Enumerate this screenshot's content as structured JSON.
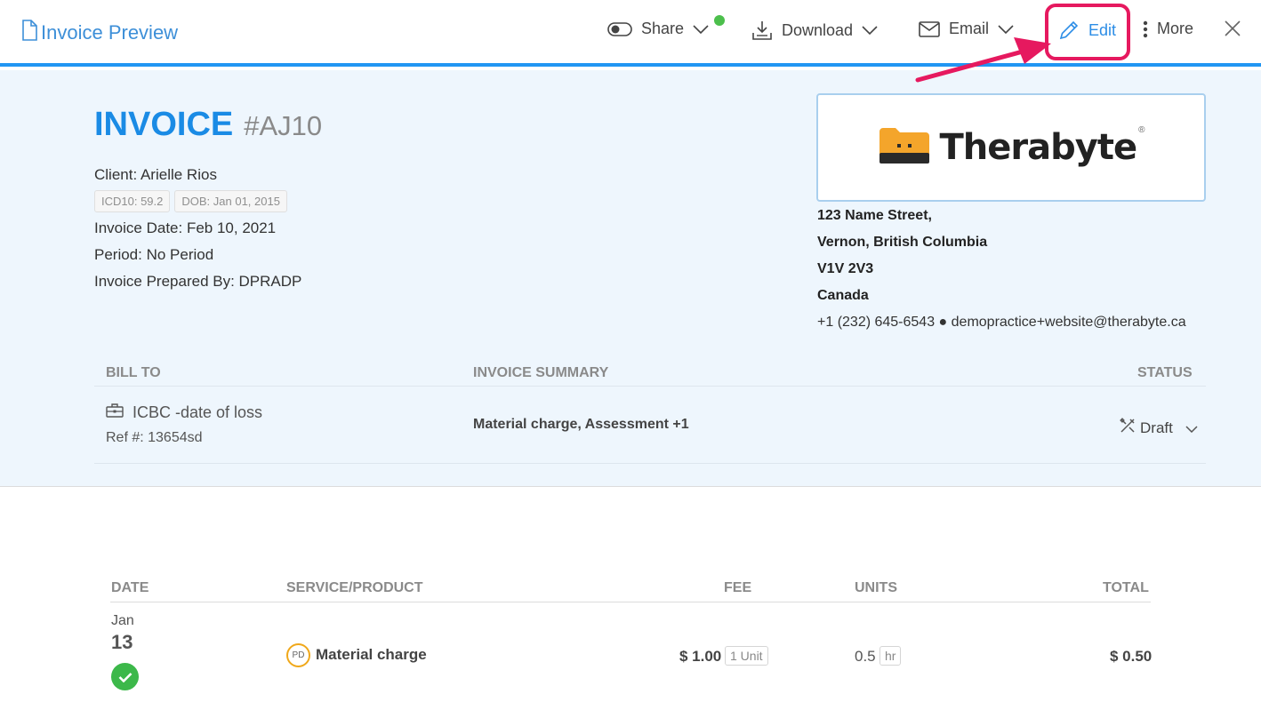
{
  "topbar": {
    "title": "Invoice Preview",
    "share_label": "Share",
    "download_label": "Download",
    "email_label": "Email",
    "edit_label": "Edit",
    "more_label": "More"
  },
  "invoice": {
    "word": "INVOICE",
    "number": "#AJ10",
    "client": "Client: Arielle Rios",
    "chips": [
      "ICD10: 59.2",
      "DOB: Jan 01, 2015"
    ],
    "invoice_date": "Invoice Date: Feb 10, 2021",
    "period": "Period: No Period",
    "prepared_by": "Invoice Prepared By: DPRADP"
  },
  "practice": {
    "logo_text": "Therabyte",
    "logo_reg": "®",
    "address": [
      "123 Name Street,",
      "Vernon, British Columbia",
      "V1V 2V3",
      "Canada"
    ],
    "contact": "+1 (232) 645-6543 ● demopractice+website@therabyte.ca"
  },
  "summary_section": {
    "headers": {
      "bill_to": "BILL TO",
      "summary": "INVOICE SUMMARY",
      "status": "STATUS"
    },
    "bill_to_name": "ICBC -date of loss",
    "ref": "Ref #: 13654sd",
    "summary_text": "Material charge, Assessment  +1",
    "status": "Draft"
  },
  "line_items": {
    "headers": {
      "date": "DATE",
      "service": "SERVICE/PRODUCT",
      "fee": "FEE",
      "units": "UNITS",
      "total": "TOTAL"
    },
    "rows": [
      {
        "month": "Jan",
        "day": "13",
        "type_badge": "PD",
        "service": "Material charge",
        "fee": "$ 1.00",
        "fee_unit": "1 Unit",
        "units": "0.5",
        "unit_type": "hr",
        "total": "$ 0.50"
      }
    ]
  },
  "colors": {
    "accent": "#2196f3",
    "highlight": "#e6195f",
    "panel_bg": "#eef6fd",
    "success": "#3cb84a"
  },
  "icons": [
    "file-icon",
    "toggle-icon",
    "chevron-down-icon",
    "download-tray-icon",
    "envelope-icon",
    "pencil-icon",
    "vertical-dots-icon",
    "close-icon",
    "briefcase-icon",
    "draft-tools-icon",
    "check-circle-icon",
    "folder-logo-icon"
  ]
}
